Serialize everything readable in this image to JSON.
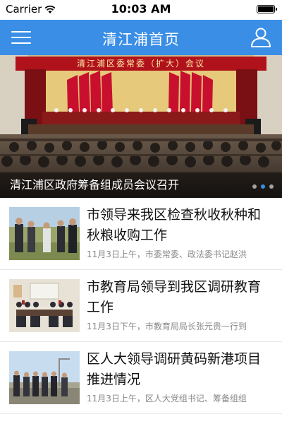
{
  "status_bar": {
    "carrier": "Carrier",
    "time": "10:03 AM"
  },
  "nav": {
    "title": "清江浦首页",
    "menu_icon": "hamburger-menu-icon",
    "user_icon": "user-profile-icon",
    "background_color": "#3a8ee6"
  },
  "banner": {
    "sign_text": "清江浦区委常委（扩大）会议",
    "caption": "清江浦区政府筹备组成员会议召开",
    "dots_count": 3,
    "active_dot": 1
  },
  "news": [
    {
      "title": "市领导来我区检查秋收秋种和秋粮收购工作",
      "meta": "11月3日上午，市委常委、政法委书记赵洪"
    },
    {
      "title": "市教育局领导到我区调研教育工作",
      "meta": "11月3日下午，市教育局局长张元贵一行到"
    },
    {
      "title": "区人大领导调研黄码新港项目推进情况",
      "meta": "11月3日上午，区人大党组书记、筹备组组"
    }
  ]
}
